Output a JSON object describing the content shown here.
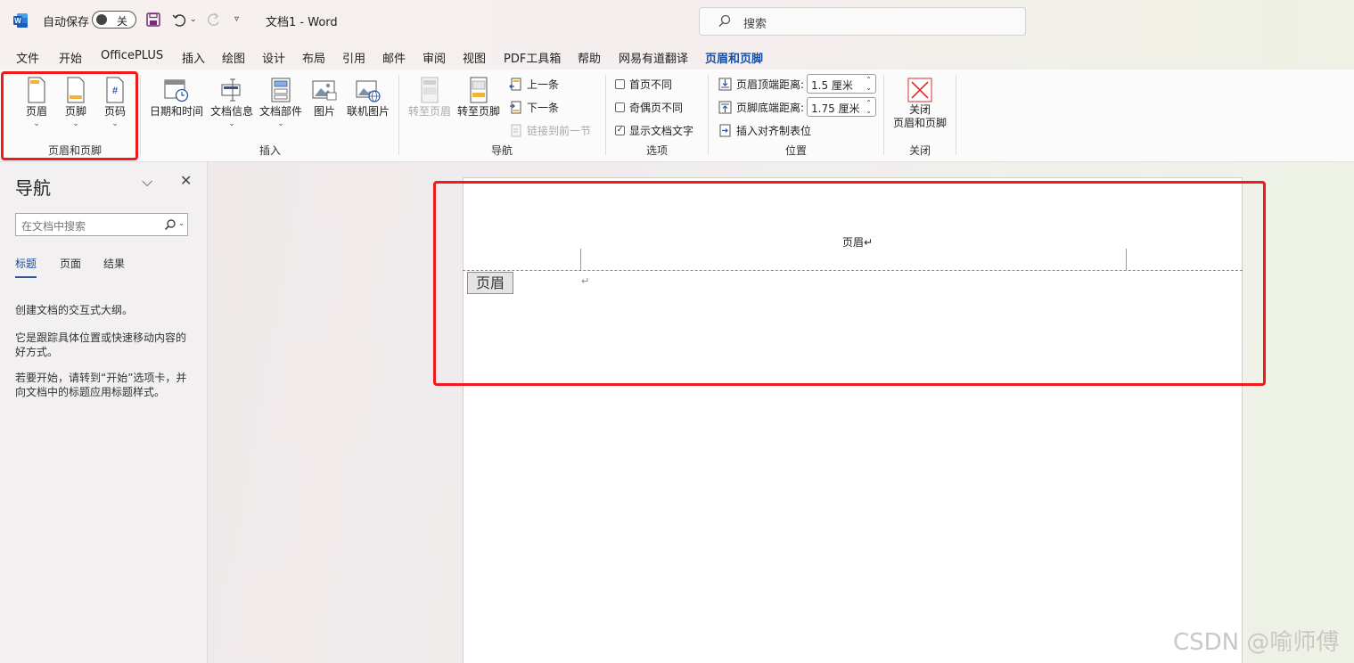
{
  "titlebar": {
    "autosave_label": "自动保存",
    "autosave_state": "关",
    "doc_title": "文档1 - Word",
    "search_placeholder": "搜索"
  },
  "menu": {
    "tabs": [
      "文件",
      "开始",
      "OfficePLUS",
      "插入",
      "绘图",
      "设计",
      "布局",
      "引用",
      "邮件",
      "审阅",
      "视图",
      "PDF工具箱",
      "帮助",
      "网易有道翻译",
      "页眉和页脚"
    ],
    "active_tab": "页眉和页脚"
  },
  "ribbon": {
    "group_hf": {
      "label": "页眉和页脚",
      "header": "页眉",
      "footer": "页脚",
      "page_number": "页码"
    },
    "group_insert": {
      "label": "插入",
      "date_time": "日期和时间",
      "doc_info": "文档信息",
      "quick_parts": "文档部件",
      "picture": "图片",
      "online_picture": "联机图片"
    },
    "group_nav": {
      "label": "导航",
      "goto_header": "转至页眉",
      "goto_footer": "转至页脚",
      "previous": "上一条",
      "next": "下一条",
      "link_previous": "链接到前一节"
    },
    "group_options": {
      "label": "选项",
      "diff_first": "首页不同",
      "diff_odd_even": "奇偶页不同",
      "show_doc_text": "显示文档文字"
    },
    "group_position": {
      "label": "位置",
      "header_top_label": "页眉顶端距离:",
      "header_top_value": "1.5 厘米",
      "footer_bottom_label": "页脚底端距离:",
      "footer_bottom_value": "1.75 厘米",
      "insert_align_tab": "插入对齐制表位"
    },
    "group_close": {
      "label": "关闭",
      "close_line1": "关闭",
      "close_line2": "页眉和页脚"
    }
  },
  "nav": {
    "title": "导航",
    "search_placeholder": "在文档中搜索",
    "tabs": [
      "标题",
      "页面",
      "结果"
    ],
    "p1": "创建文档的交互式大纲。",
    "p2": "它是跟踪具体位置或快速移动内容的好方式。",
    "p3": "若要开始，请转到“开始”选项卡，并向文档中的标题应用标题样式。"
  },
  "document": {
    "header_text": "页眉↵",
    "header_tag": "页眉",
    "para_mark": "↵"
  },
  "watermark": "CSDN @喻师傅"
}
